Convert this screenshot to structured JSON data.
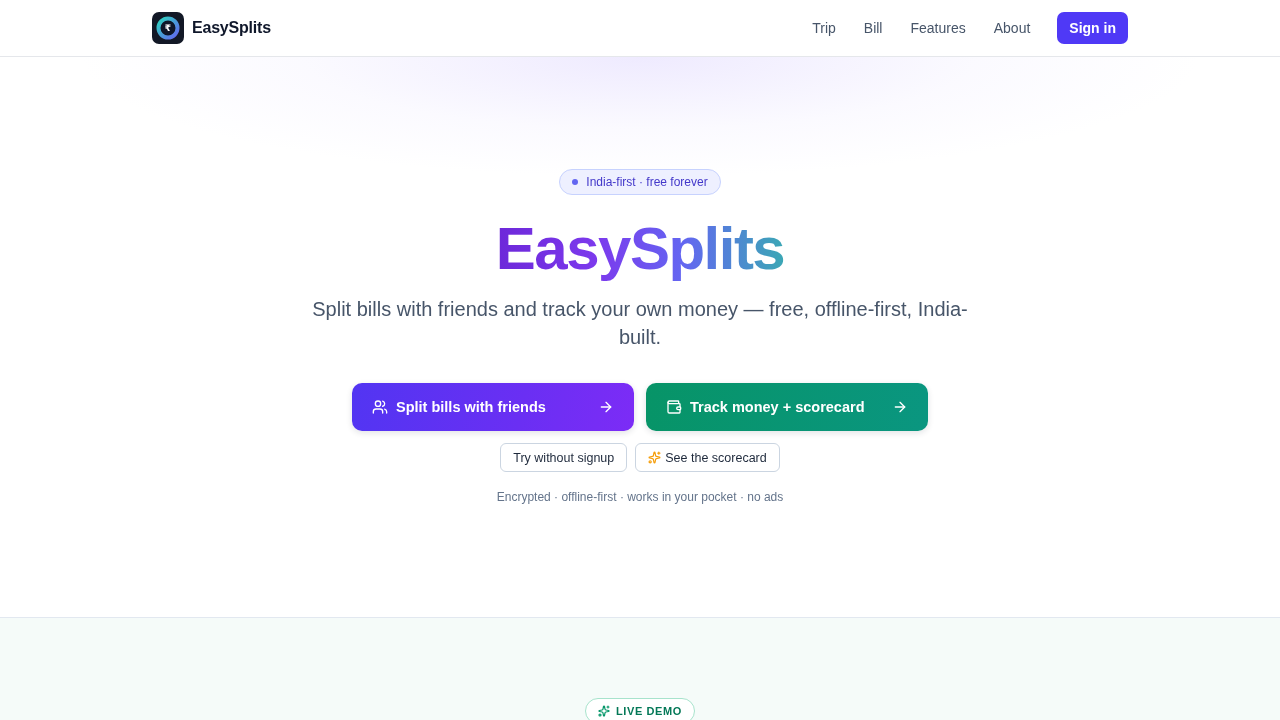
{
  "header": {
    "brand": {
      "symbol": "₹",
      "name": "EasySplits"
    },
    "nav": [
      "Trip",
      "Bill",
      "Features",
      "About"
    ],
    "sign_in": "Sign in"
  },
  "hero": {
    "badge": "India-first · free forever",
    "title": "EasySplits",
    "subtitle": "Split bills with friends and track your own money — free, offline-first, India-built.",
    "primary_actions": [
      {
        "kind": "split",
        "label": "Split bills with friends"
      },
      {
        "kind": "track",
        "label": "Track money + scorecard"
      }
    ],
    "secondary_actions": [
      {
        "kind": "plain",
        "label": "Try without signup"
      },
      {
        "kind": "sparkle",
        "label": "See the scorecard"
      }
    ],
    "tagline": "Encrypted · offline-first · works in your pocket · no ads"
  },
  "demo_section": {
    "badge": "LIVE DEMO"
  }
}
